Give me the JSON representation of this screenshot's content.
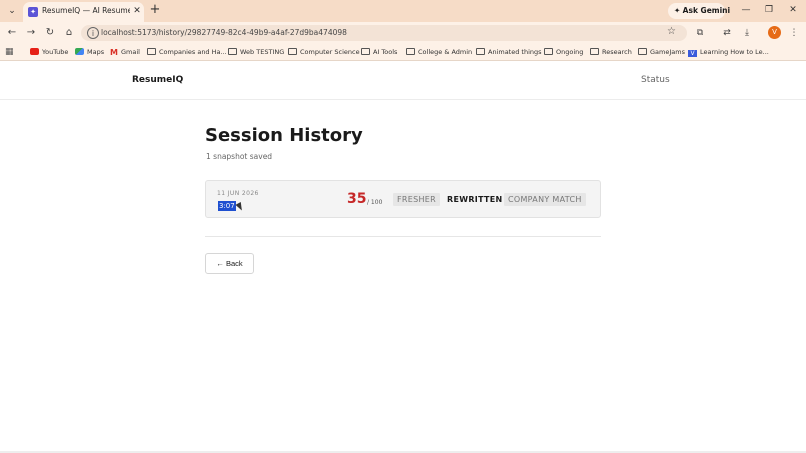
{
  "browser": {
    "tab_title": "ResumeIQ — AI Resume Analyz",
    "tab_favicon": "✦",
    "tab_close": "✕",
    "new_tab": "+",
    "tab_menu": "⌄",
    "ask_gemini_label": "Ask Gemini",
    "url": "localhost:5173/history/29827749-82c4-49b9-a4af-27d9ba474098",
    "profile_initial": "V",
    "window_controls": [
      "—",
      "❐",
      "✕"
    ],
    "icons": {
      "back": "←",
      "forward": "→",
      "reload": "↻",
      "home": "⌂",
      "info": "i",
      "star": "☆",
      "extensions": "⧉",
      "translate": "⇄",
      "download": "⤓",
      "menu": "⋮",
      "apps": "▦"
    }
  },
  "bookmarks": [
    {
      "label": "YouTube",
      "icon": "youtube-icon"
    },
    {
      "label": "Maps",
      "icon": "maps-icon"
    },
    {
      "label": "Gmail",
      "icon": "gmail-icon"
    },
    {
      "label": "Companies and Ha...",
      "icon": "folder-icon"
    },
    {
      "label": "Web TESTING",
      "icon": "folder-icon"
    },
    {
      "label": "Computer Science",
      "icon": "folder-icon"
    },
    {
      "label": "AI Tools",
      "icon": "folder-icon"
    },
    {
      "label": "College & Admin",
      "icon": "folder-icon"
    },
    {
      "label": "Animated things",
      "icon": "folder-icon"
    },
    {
      "label": "Ongoing",
      "icon": "folder-icon"
    },
    {
      "label": "Research",
      "icon": "folder-icon"
    },
    {
      "label": "GameJams",
      "icon": "folder-icon"
    },
    {
      "label": "Learning How to Le...",
      "icon": "v-icon"
    }
  ],
  "header": {
    "brand": "ResumeIQ",
    "nav_status": "Status"
  },
  "main": {
    "title": "Session History",
    "subtitle": "1 snapshot saved",
    "snapshots": [
      {
        "date": "11 JUN 2026",
        "time": "3:07",
        "score": "35",
        "score_max": "/ 100",
        "tags": [
          "FRESHER",
          "REWRITTEN",
          "COMPANY MATCH"
        ]
      }
    ],
    "back_label": "← Back"
  },
  "colors": {
    "chrome": "#f6dcc7",
    "score": "#c62828",
    "selection": "#1e4fd0",
    "favicon": "#5b54d6"
  }
}
